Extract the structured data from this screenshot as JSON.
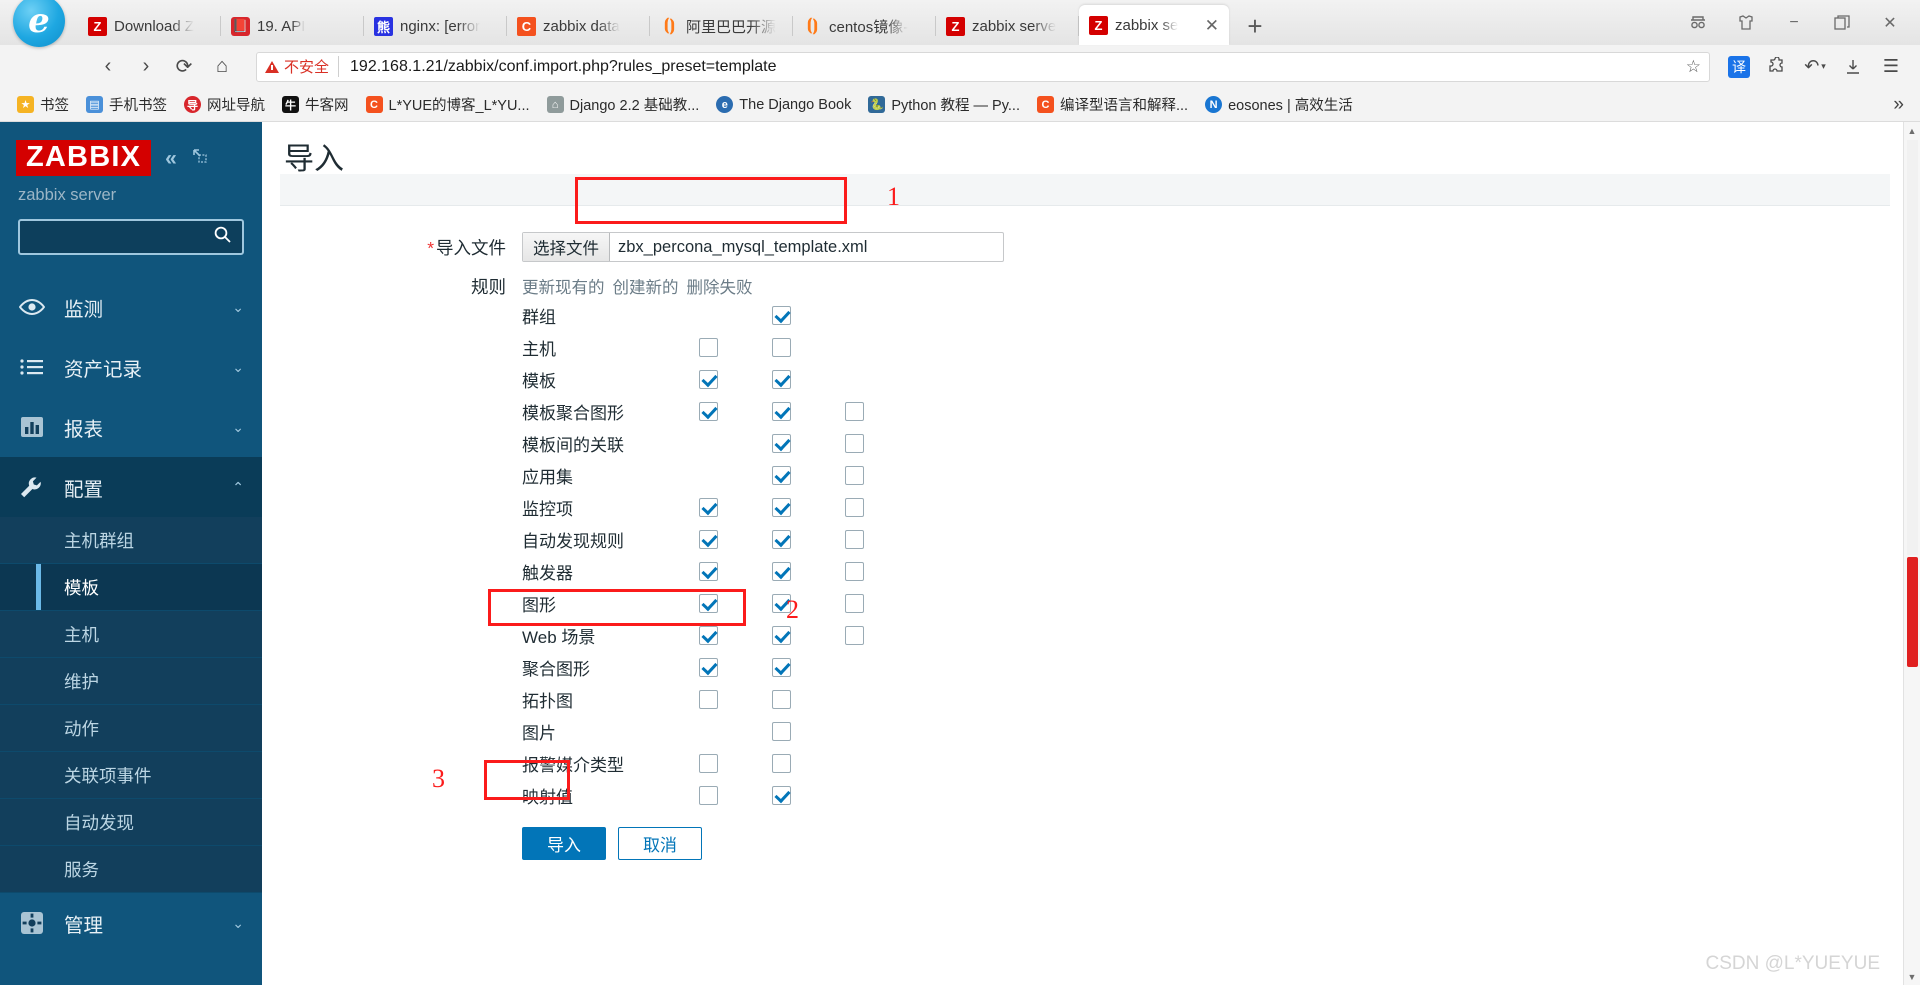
{
  "browser": {
    "tabs": [
      {
        "label": "Download Z",
        "icon": "zabbix-icon",
        "active": false
      },
      {
        "label": "19. API",
        "icon": "book-icon",
        "active": false
      },
      {
        "label": "nginx: [error",
        "icon": "baidu-icon",
        "active": false
      },
      {
        "label": "zabbix data",
        "icon": "csdn-icon",
        "active": false
      },
      {
        "label": "阿里巴巴开源",
        "icon": "link-icon",
        "active": false
      },
      {
        "label": "centos镜像-",
        "icon": "link-icon",
        "active": false
      },
      {
        "label": "zabbix serve",
        "icon": "zabbix-icon",
        "active": false
      },
      {
        "label": "zabbix se",
        "icon": "zabbix-icon",
        "active": true
      }
    ],
    "new_tab_label": "+",
    "close_tab_label": "✕",
    "window_controls": {
      "reader": "⛺",
      "wardrobe": "♖",
      "minimize": "−",
      "maximize": "❐",
      "close": "✕"
    },
    "nav": {
      "back": "‹",
      "forward": "›",
      "reload": "⟳",
      "home": "⌂"
    },
    "omnibox": {
      "security_label": "不安全",
      "url": "192.168.1.21/zabbix/conf.import.php?rules_preset=template",
      "star": "☆"
    },
    "toolbar_right": {
      "translate": "译",
      "extensions": "puzzle-icon",
      "history": "↶",
      "download": "↓",
      "menu": "☰"
    },
    "bookmarks": [
      {
        "label": "书签",
        "icon": "star-icon",
        "color": "#f5b323"
      },
      {
        "label": "手机书签",
        "icon": "phone-bookmark-icon",
        "color": "#4a90d9"
      },
      {
        "label": "网址导航",
        "icon": "nav-icon",
        "color": "#d8262c"
      },
      {
        "label": "牛客网",
        "icon": "nowcoder-icon",
        "color": "#111111"
      },
      {
        "label": "L*YUE的博客_L*YU...",
        "icon": "csdn-icon",
        "color": "#f4511e"
      },
      {
        "label": "Django 2.2 基础教...",
        "icon": "django-icon",
        "color": "#8f9b9b"
      },
      {
        "label": "The Django Book",
        "icon": "globe-icon",
        "color": "#2b6cb0"
      },
      {
        "label": "Python 教程 — Py...",
        "icon": "python-icon",
        "color": "#306998"
      },
      {
        "label": "编译型语言和解释...",
        "icon": "csdn-icon",
        "color": "#f4511e"
      },
      {
        "label": "eosones | 高效生活",
        "icon": "n-icon",
        "color": "#1976d2"
      }
    ],
    "bookmarks_overflow": "»"
  },
  "sidebar": {
    "logo": "ZABBIX",
    "collapse_icon": "«",
    "pin_icon": "⤢",
    "server_name": "zabbix server",
    "search_placeholder": "",
    "search_icon": "search-icon",
    "nav": [
      {
        "label": "监测",
        "icon": "eye-icon",
        "chevron": "⌄",
        "expanded": false
      },
      {
        "label": "资产记录",
        "icon": "list-icon",
        "chevron": "⌄",
        "expanded": false
      },
      {
        "label": "报表",
        "icon": "chart-icon",
        "chevron": "⌄",
        "expanded": false
      },
      {
        "label": "配置",
        "icon": "wrench-icon",
        "chevron": "⌃",
        "expanded": true
      }
    ],
    "config_submenu": [
      {
        "label": "主机群组",
        "selected": false
      },
      {
        "label": "模板",
        "selected": true
      },
      {
        "label": "主机",
        "selected": false
      },
      {
        "label": "维护",
        "selected": false
      },
      {
        "label": "动作",
        "selected": false
      },
      {
        "label": "关联项事件",
        "selected": false
      },
      {
        "label": "自动发现",
        "selected": false
      },
      {
        "label": "服务",
        "selected": false
      }
    ],
    "admin": {
      "label": "管理",
      "icon": "gear-icon",
      "chevron": "⌄"
    }
  },
  "main": {
    "title": "导入",
    "file_row": {
      "label": "导入文件",
      "required_mark": "*",
      "choose_button": "选择文件",
      "file_name": "zbx_percona_mysql_template.xml"
    },
    "rules_label": "规则",
    "rules_columns": [
      "更新现有的",
      "创建新的",
      "删除失败"
    ],
    "rules": [
      {
        "name": "群组",
        "update": null,
        "create": true,
        "delete": null
      },
      {
        "name": "主机",
        "update": false,
        "create": false,
        "delete": null
      },
      {
        "name": "模板",
        "update": true,
        "create": true,
        "delete": null
      },
      {
        "name": "模板聚合图形",
        "update": true,
        "create": true,
        "delete": false
      },
      {
        "name": "模板间的关联",
        "update": null,
        "create": true,
        "delete": false
      },
      {
        "name": "应用集",
        "update": null,
        "create": true,
        "delete": false
      },
      {
        "name": "监控项",
        "update": true,
        "create": true,
        "delete": false
      },
      {
        "name": "自动发现规则",
        "update": true,
        "create": true,
        "delete": false
      },
      {
        "name": "触发器",
        "update": true,
        "create": true,
        "delete": false
      },
      {
        "name": "图形",
        "update": true,
        "create": true,
        "delete": false
      },
      {
        "name": "Web 场景",
        "update": true,
        "create": true,
        "delete": false
      },
      {
        "name": "聚合图形",
        "update": true,
        "create": true,
        "delete": null
      },
      {
        "name": "拓扑图",
        "update": false,
        "create": false,
        "delete": null
      },
      {
        "name": "图片",
        "update": null,
        "create": false,
        "delete": null
      },
      {
        "name": "报警媒介类型",
        "update": false,
        "create": false,
        "delete": null
      },
      {
        "name": "映射值",
        "update": false,
        "create": true,
        "delete": null
      }
    ],
    "buttons": {
      "import": "导入",
      "cancel": "取消"
    }
  },
  "annotations": [
    {
      "number": "1"
    },
    {
      "number": "2"
    },
    {
      "number": "3"
    }
  ],
  "watermark": "CSDN @L*YUEYUE",
  "colors": {
    "accent": "#0275b8",
    "zabbix_red": "#d40000",
    "annotation_red": "#fb1b1b",
    "sidebar": "#10557c"
  }
}
